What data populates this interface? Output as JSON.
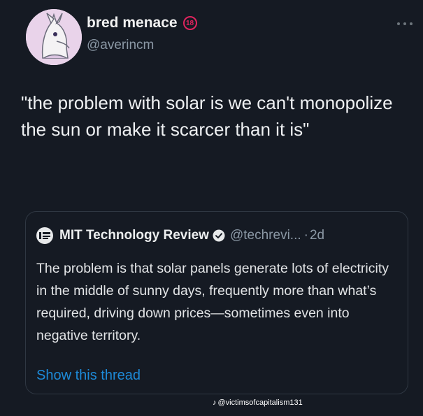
{
  "tweet": {
    "display_name": "bred menace",
    "age_badge": "18",
    "handle": "@averincm",
    "text": "\"the problem with solar is we can't monopolize the sun or make it scarcer than it is\""
  },
  "quoted_tweet": {
    "name": "MIT Technology Review",
    "handle": "@techrevi...",
    "separator": "·",
    "time": "2d",
    "text": "The problem is that solar panels generate lots of electricity in the middle of sunny days, frequently more than what’s required, driving down prices—sometimes even into negative territory.",
    "show_thread": "Show this thread"
  },
  "watermark": {
    "icon": "tiktok-icon",
    "text": "@victimsofcapitalism131"
  },
  "colors": {
    "background": "#151a23",
    "link": "#1d8ad8",
    "verified": "#e7e9ea",
    "age_badge": "#e0245e"
  }
}
